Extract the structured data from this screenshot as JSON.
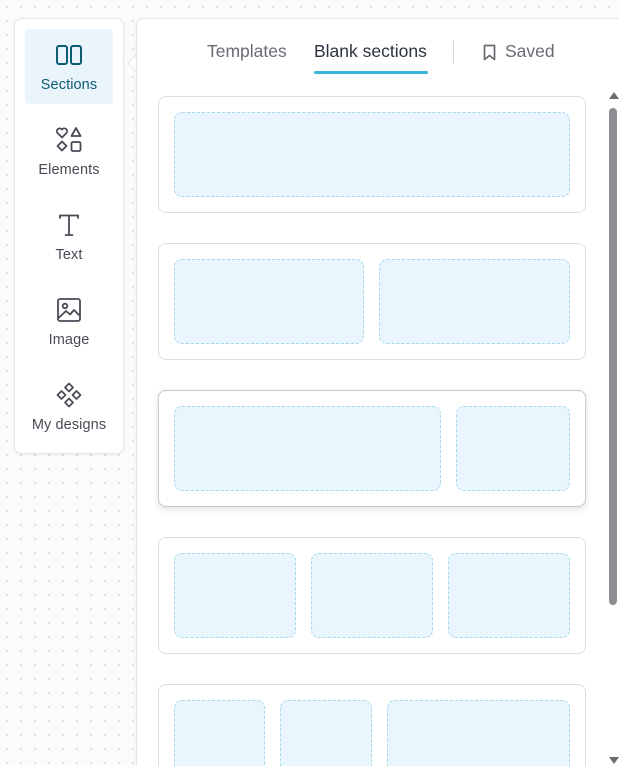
{
  "sidebar": {
    "items": [
      {
        "label": "Sections",
        "icon": "sections-icon",
        "active": true
      },
      {
        "label": "Elements",
        "icon": "elements-icon",
        "active": false
      },
      {
        "label": "Text",
        "icon": "text-icon",
        "active": false
      },
      {
        "label": "Image",
        "icon": "image-icon",
        "active": false
      },
      {
        "label": "My designs",
        "icon": "my-designs-icon",
        "active": false
      }
    ]
  },
  "tabs": {
    "templates": "Templates",
    "blank_sections": "Blank sections",
    "saved": "Saved",
    "active": "blank_sections"
  },
  "sections": [
    {
      "name": "one-column",
      "columns": 1
    },
    {
      "name": "two-columns",
      "columns": 2
    },
    {
      "name": "two-columns-wide-narrow",
      "columns": 2
    },
    {
      "name": "three-columns",
      "columns": 3
    },
    {
      "name": "three-columns-narrow-narrow-wide",
      "columns": 3
    }
  ],
  "colors": {
    "accent": "#39b6d8",
    "active_bg": "#e9f5fb",
    "active_text": "#0e5c74",
    "column_fill": "#eaf6fd",
    "column_border": "#a8d9ea"
  }
}
